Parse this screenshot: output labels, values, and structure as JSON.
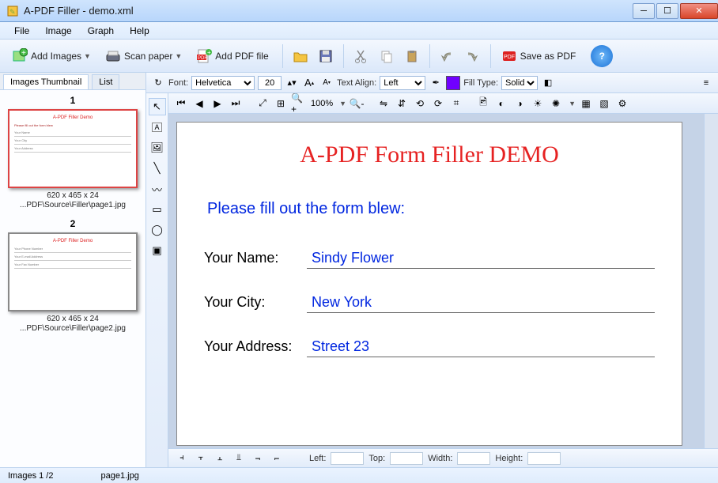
{
  "window": {
    "title": "A-PDF Filler - demo.xml"
  },
  "menu": {
    "file": "File",
    "image": "Image",
    "graph": "Graph",
    "help": "Help"
  },
  "toolbar": {
    "add_images": "Add Images",
    "scan_paper": "Scan paper",
    "add_pdf": "Add PDF file",
    "save_pdf": "Save as PDF"
  },
  "sidebar": {
    "tab_thumb": "Images Thumbnail",
    "tab_list": "List",
    "thumbs": [
      {
        "num": "1",
        "dim": "620 x 465 x 24",
        "path": "...PDF\\Source\\Filler\\page1.jpg"
      },
      {
        "num": "2",
        "dim": "620 x 465 x 24",
        "path": "...PDF\\Source\\Filler\\page2.jpg"
      }
    ]
  },
  "format": {
    "font_label": "Font:",
    "font_value": "Helvetica",
    "size_value": "20",
    "align_label": "Text Align:",
    "align_value": "Left",
    "fill_label": "Fill Type:",
    "fill_value": "Solid"
  },
  "edit": {
    "zoom": "100%"
  },
  "document": {
    "title": "A-PDF Form Filler DEMO",
    "instruction": "Please fill out the form blew:",
    "fields": [
      {
        "label": "Your Name:",
        "value": "Sindy Flower"
      },
      {
        "label": "Your City:",
        "value": "New York"
      },
      {
        "label": "Your Address:",
        "value": "Street 23"
      }
    ]
  },
  "position": {
    "left_label": "Left:",
    "left_val": "",
    "top_label": "Top:",
    "top_val": "",
    "width_label": "Width:",
    "width_val": "",
    "height_label": "Height:",
    "height_val": ""
  },
  "status": {
    "pages": "Images 1 /2",
    "file": "page1.jpg"
  }
}
